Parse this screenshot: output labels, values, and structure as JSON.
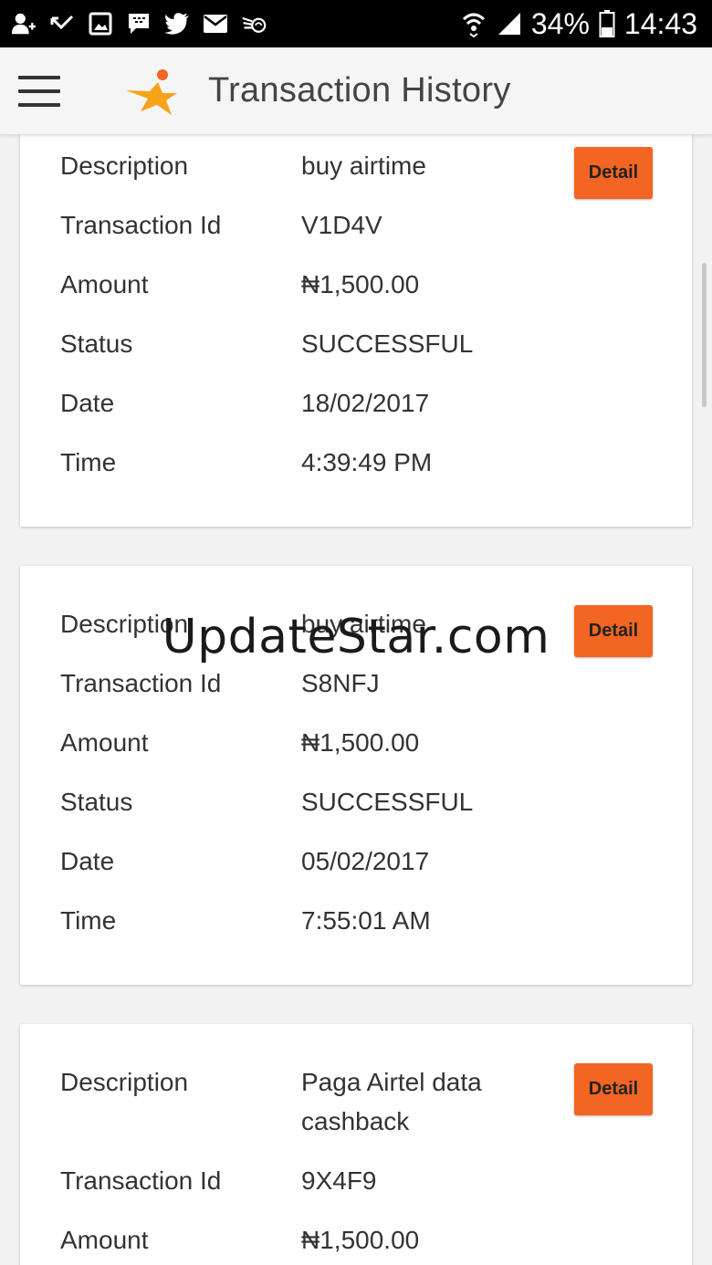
{
  "status_bar": {
    "icons_left": [
      "add-person-icon",
      "missed-call-icon",
      "image-icon",
      "bbm-icon",
      "twitter-icon",
      "mail-icon",
      "hand-icon"
    ],
    "battery": "34%",
    "time": "14:43"
  },
  "header": {
    "title": "Transaction History"
  },
  "labels": {
    "description": "Description",
    "transaction_id": "Transaction Id",
    "amount": "Amount",
    "status": "Status",
    "date": "Date",
    "time": "Time",
    "detail_button": "Detail"
  },
  "transactions": [
    {
      "description": "buy airtime",
      "transaction_id": "V1D4V",
      "amount": "₦1,500.00",
      "status": "SUCCESSFUL",
      "date": "18/02/2017",
      "time": "4:39:49 PM"
    },
    {
      "description": "buy airtime",
      "transaction_id": "S8NFJ",
      "amount": "₦1,500.00",
      "status": "SUCCESSFUL",
      "date": "05/02/2017",
      "time": "7:55:01 AM"
    },
    {
      "description_line1": "Paga Airtel data",
      "description_line2": "cashback",
      "transaction_id": "9X4F9",
      "amount": "₦1,500.00"
    }
  ],
  "watermark": "UpdateStar.com",
  "colors": {
    "accent": "#f26522",
    "logo_star": "#f7a21b",
    "logo_dot": "#f26522"
  }
}
